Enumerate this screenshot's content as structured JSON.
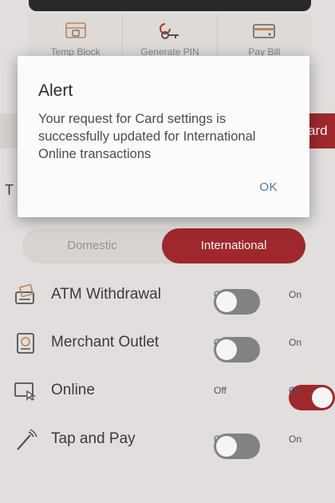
{
  "quick_actions": [
    {
      "label": "Temp Block",
      "icon": "lock-card-icon"
    },
    {
      "label": "Generate PIN",
      "icon": "key-icon"
    },
    {
      "label": "Pay Bill",
      "icon": "card-icon"
    }
  ],
  "partial_tab_text": "ard",
  "partial_left_text": "T",
  "segments": {
    "domestic": "Domestic",
    "international": "International",
    "selected": "International"
  },
  "settings": [
    {
      "label": "ATM Withdrawal",
      "icon": "atm-icon",
      "off_label": "Off",
      "on_label": "On",
      "state": "off"
    },
    {
      "label": "Merchant Outlet",
      "icon": "merchant-icon",
      "off_label": "Off",
      "on_label": "On",
      "state": "off"
    },
    {
      "label": "Online",
      "icon": "online-icon",
      "off_label": "Off",
      "on_label": "On",
      "state": "on"
    },
    {
      "label": "Tap and Pay",
      "icon": "tap-pay-icon",
      "off_label": "Off",
      "on_label": "On",
      "state": "off"
    }
  ],
  "alert": {
    "title": "Alert",
    "message": "Your request for Card settings is successfully updated for International Online transactions",
    "ok_label": "OK"
  },
  "colors": {
    "accent": "#a52a2e",
    "toggle_off": "#888888",
    "link": "#4a7aa6"
  }
}
